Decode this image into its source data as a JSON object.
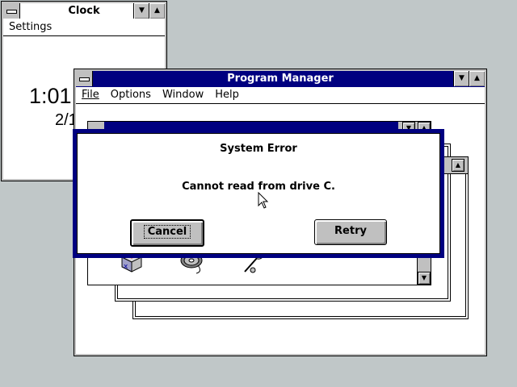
{
  "clock": {
    "title": "Clock",
    "menu": "Settings",
    "time": "1:01",
    "date": "2/1"
  },
  "program_manager": {
    "title": "Program Manager",
    "menu": [
      "File",
      "Options",
      "Window",
      "Help"
    ]
  },
  "dialog": {
    "title": "System Error",
    "message": "Cannot read from drive C.",
    "cancel_label": "Cancel",
    "retry_label": "Retry"
  },
  "colors": {
    "desktop": "#c0c7c8",
    "active_title": "#000080",
    "dialog_border": "#000080"
  },
  "icons": [
    "minimize-arrow-icon",
    "maximize-arrow-icon",
    "scroll-up-icon",
    "scroll-down-icon",
    "setup-icon",
    "media-player-icon",
    "sound-recorder-icon"
  ]
}
